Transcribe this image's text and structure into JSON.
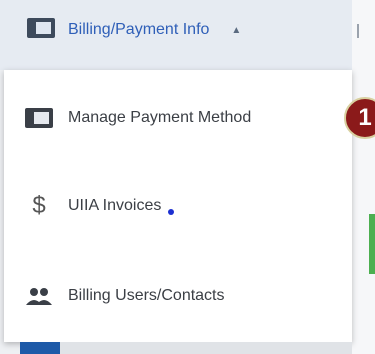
{
  "nav": {
    "billing_label": "Billing/Payment Info",
    "caret_icon": "caret-up-icon",
    "billing_icon": "credit-card-icon"
  },
  "menu": {
    "items": [
      {
        "label": "Manage Payment Method",
        "icon": "credit-card-icon"
      },
      {
        "label": "UIIA Invoices",
        "icon": "dollar-icon",
        "glyph": "$"
      },
      {
        "label": "Billing Users/Contacts",
        "icon": "users-icon"
      }
    ]
  },
  "annotation": {
    "number": "1",
    "color": "#8b1a1a"
  },
  "colors": {
    "nav_text": "#2f5fb8",
    "menu_text": "#3b3f45",
    "accent": "#1e5aa8"
  }
}
